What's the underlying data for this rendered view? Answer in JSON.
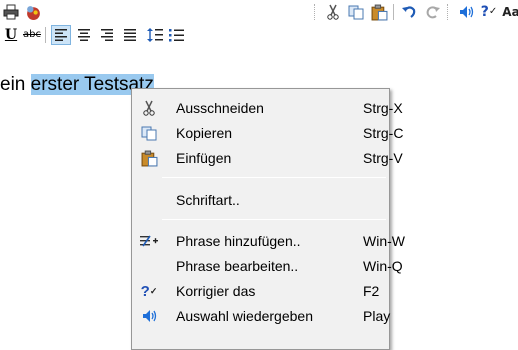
{
  "toolbar": {
    "row1": [
      {
        "icon": "print-icon",
        "glyph": "🖶"
      },
      {
        "icon": "app-badge-icon",
        "glyph": "✿"
      },
      {
        "icon": "cut-icon",
        "glyph": "✂"
      },
      {
        "icon": "copy-icon",
        "glyph": "⧉"
      },
      {
        "icon": "paste-icon",
        "glyph": "📋"
      },
      {
        "icon": "undo-icon",
        "glyph": "↶"
      },
      {
        "icon": "redo-icon",
        "glyph": "↷"
      },
      {
        "icon": "speaker-icon",
        "glyph": "🔈"
      },
      {
        "icon": "spellcheck-icon",
        "glyph": "?✓"
      },
      {
        "icon": "font-size-icon",
        "glyph": "Aa"
      }
    ],
    "row2": [
      {
        "icon": "underline-icon",
        "glyph": "U"
      },
      {
        "icon": "strikethrough-icon",
        "glyph": "abc"
      },
      {
        "icon": "align-left-icon",
        "glyph": "≡"
      },
      {
        "icon": "align-center-icon",
        "glyph": "≡"
      },
      {
        "icon": "align-right-icon",
        "glyph": "≡"
      },
      {
        "icon": "justify-icon",
        "glyph": "≣"
      },
      {
        "icon": "line-spacing-icon",
        "glyph": "⇕"
      },
      {
        "icon": "bullet-list-icon",
        "glyph": "☰"
      }
    ]
  },
  "editor": {
    "text_before": "ein ",
    "text_selected": "erster Testsatz"
  },
  "context_menu": {
    "items": [
      {
        "label": "Ausschneiden",
        "shortcut": "Strg-X",
        "icon": "cut-icon",
        "glyph": "✂"
      },
      {
        "label": "Kopieren",
        "shortcut": "Strg-C",
        "icon": "copy-icon",
        "glyph": "⧉"
      },
      {
        "label": "Einfügen",
        "shortcut": "Strg-V",
        "icon": "paste-icon",
        "glyph": "📋"
      },
      {
        "label": "Schriftart..",
        "shortcut": "",
        "icon": "",
        "glyph": ""
      },
      {
        "label": "Phrase hinzufügen..",
        "shortcut": "Win-W",
        "icon": "add-phrase-icon",
        "glyph": "✎+"
      },
      {
        "label": "Phrase bearbeiten..",
        "shortcut": "Win-Q",
        "icon": "",
        "glyph": ""
      },
      {
        "label": "Korrigier das",
        "shortcut": "F2",
        "icon": "spellcheck-icon",
        "glyph": "?✓"
      },
      {
        "label": "Auswahl wiedergeben",
        "shortcut": "Play",
        "icon": "speaker-icon",
        "glyph": "🔈"
      }
    ]
  },
  "colors": {
    "selection": "#99c9ef",
    "menu_background": "#f1f1f1",
    "speaker_blue": "#1e6fd9",
    "spell_blue": "#1f4fb5"
  }
}
